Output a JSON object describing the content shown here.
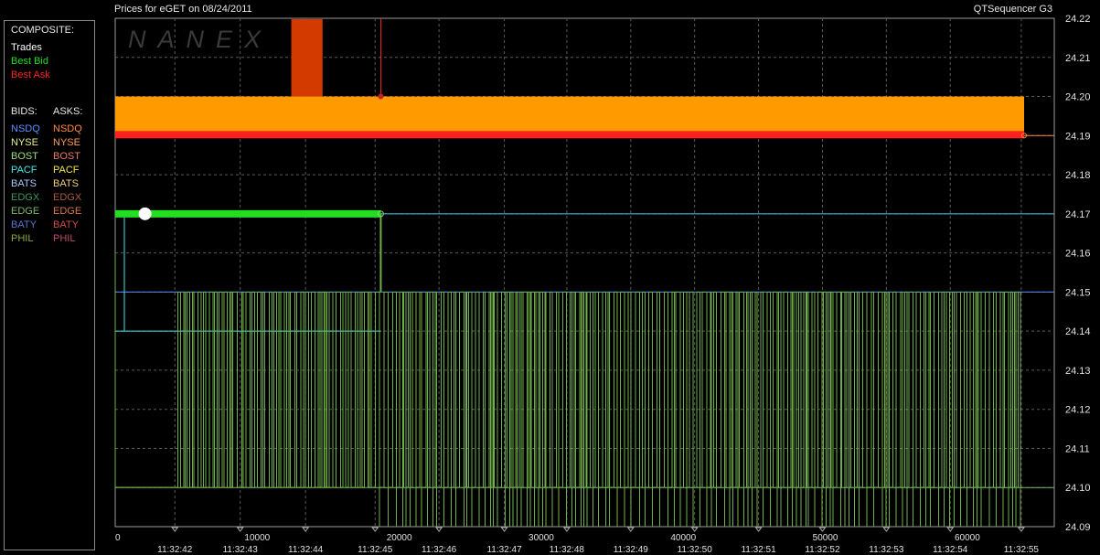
{
  "header": {
    "title": "Prices for  eGET  on  08/24/2011",
    "app_name": "QTSequencer G3"
  },
  "legend": {
    "composite_title": "COMPOSITE:",
    "composite_items": [
      {
        "label": "Trades",
        "color": "#ffffff"
      },
      {
        "label": "Best Bid",
        "color": "#22dd22"
      },
      {
        "label": "Best Ask",
        "color": "#ff2020"
      }
    ],
    "bids_title": "BIDS:",
    "asks_title": "ASKS:",
    "exchanges": [
      {
        "bid": "NSDQ",
        "bid_color": "#5a8cff",
        "ask": "NSDQ",
        "ask_color": "#ff8a3a"
      },
      {
        "bid": "NYSE",
        "bid_color": "#e6f08a",
        "ask": "NYSE",
        "ask_color": "#ff9a5a"
      },
      {
        "bid": "BOST",
        "bid_color": "#9adf7a",
        "ask": "BOST",
        "ask_color": "#e77a6a"
      },
      {
        "bid": "PACF",
        "bid_color": "#40e8e8",
        "ask": "PACF",
        "ask_color": "#f0e84a"
      },
      {
        "bid": "BATS",
        "bid_color": "#aac8ff",
        "ask": "BATS",
        "ask_color": "#f0d07a"
      },
      {
        "bid": "EDGX",
        "bid_color": "#3a9a5a",
        "ask": "EDGX",
        "ask_color": "#b05a3a"
      },
      {
        "bid": "EDGE",
        "bid_color": "#7ab86a",
        "ask": "EDGE",
        "ask_color": "#d8784a"
      },
      {
        "bid": "BATY",
        "bid_color": "#5a78d0",
        "ask": "BATY",
        "ask_color": "#d04a4a"
      },
      {
        "bid": "PHIL",
        "bid_color": "#8aa84a",
        "ask": "PHIL",
        "ask_color": "#c04a6a"
      }
    ]
  },
  "watermark": "NANEX",
  "chart_data": {
    "type": "line",
    "title": "Prices for  eGET  on  08/24/2011",
    "x_ticks": [
      "0",
      "10000",
      "20000",
      "30000",
      "40000",
      "50000",
      "60000"
    ],
    "x_tick_values": [
      0,
      10000,
      20000,
      30000,
      40000,
      50000,
      60000
    ],
    "time_ticks": [
      "11:32:42",
      "11:32:43",
      "11:32:44",
      "11:32:45",
      "11:32:46",
      "11:32:47",
      "11:32:48",
      "11:32:49",
      "11:32:50",
      "11:32:51",
      "11:32:52",
      "11:32:53",
      "11:32:54",
      "11:32:55"
    ],
    "time_tick_x": [
      4200,
      8800,
      13400,
      18300,
      22800,
      27400,
      31800,
      36300,
      40800,
      45300,
      49800,
      54300,
      58800,
      63800
    ],
    "xlim": [
      0,
      64000
    ],
    "ylim": [
      24.09,
      24.22
    ],
    "y_ticks": [
      "24.22",
      "24.21",
      "24.20",
      "24.19",
      "24.18",
      "24.17",
      "24.16",
      "24.15",
      "24.14",
      "24.13",
      "24.12",
      "24.11",
      "24.10",
      "24.09"
    ],
    "y_tick_values": [
      24.22,
      24.21,
      24.2,
      24.19,
      24.18,
      24.17,
      24.16,
      24.15,
      24.14,
      24.13,
      24.12,
      24.11,
      24.1,
      24.09
    ],
    "grid": true,
    "series": [
      {
        "name": "Best Ask",
        "color": "#ff2020",
        "x": [
          0,
          64000
        ],
        "y": [
          24.19,
          24.19
        ]
      },
      {
        "name": "Best Bid",
        "color": "#22dd22",
        "x": [
          0,
          18700
        ],
        "y": [
          24.17,
          24.17
        ]
      },
      {
        "name": "Trades",
        "color": "#ffffff",
        "x": [
          2100
        ],
        "y": [
          24.17
        ]
      }
    ],
    "ask_band": {
      "color": "#ff9a00",
      "x": [
        0,
        64000
      ],
      "y": [
        24.19,
        24.2
      ]
    },
    "ask_spike": {
      "color": "#d23a00",
      "x": [
        12400,
        14600
      ],
      "y": [
        24.2,
        24.22
      ]
    },
    "ask_marker": {
      "color": "#ff2020",
      "x": 18700,
      "y_from": 24.22,
      "y_to": 24.2
    },
    "reference_lines": [
      {
        "color": "#40c8e8",
        "x_from": 18700,
        "x_to": 68000,
        "y": 24.17
      },
      {
        "color": "#5a8cff",
        "x_from": 0,
        "x_to": 68000,
        "y": 24.15
      },
      {
        "color": "#7ab86a",
        "x_from": 0,
        "x_to": 68000,
        "y": 24.1
      },
      {
        "color": "#40e8e8",
        "x_from": 0,
        "x_to": 18700,
        "y": 24.14
      }
    ],
    "oscillation": {
      "color": "#6fb04a",
      "y_high": 24.15,
      "y_low": 24.1,
      "x_from": 4400,
      "x_to": 63800
    }
  }
}
